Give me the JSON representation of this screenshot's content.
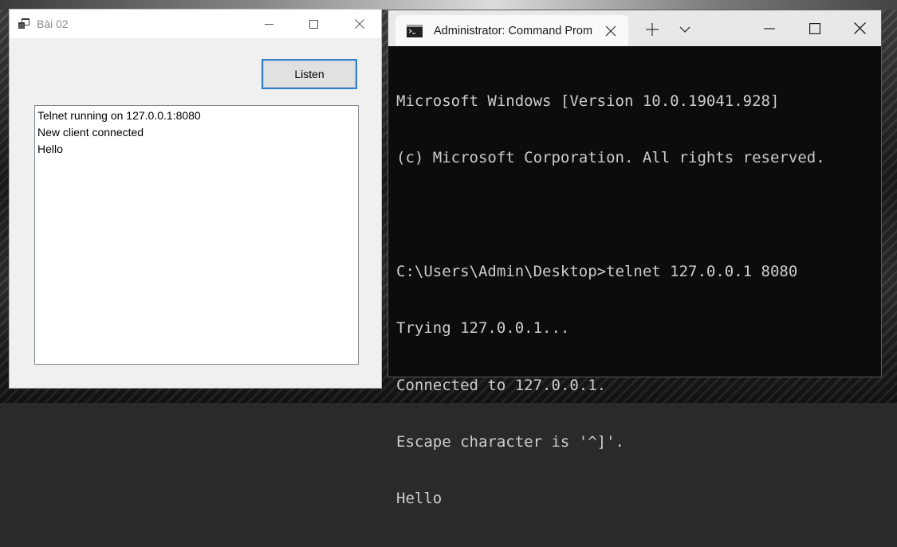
{
  "form_window": {
    "title": "Bài 02",
    "listen_button": "Listen",
    "log_lines": [
      "Telnet running on 127.0.0.1:8080",
      "New client connected",
      "Hello"
    ]
  },
  "terminal_window": {
    "tab_title": "Administrator: Command Prom",
    "lines": [
      "Microsoft Windows [Version 10.0.19041.928]",
      "(c) Microsoft Corporation. All rights reserved.",
      "",
      "C:\\Users\\Admin\\Desktop>telnet 127.0.0.1 8080",
      "Trying 127.0.0.1...",
      "Connected to 127.0.0.1.",
      "Escape character is '^]'.",
      "Hello"
    ]
  },
  "icons": {
    "form_app": "winforms-app-icon",
    "minimize": "minimize-icon",
    "maximize": "maximize-icon",
    "close": "close-icon",
    "cmd": "command-prompt-icon",
    "new_tab": "plus-icon",
    "dropdown": "chevron-down-icon"
  },
  "colors": {
    "accent_border": "#2d7fd2",
    "terminal_bg": "#0c0c0c",
    "terminal_text": "#cccccc"
  }
}
